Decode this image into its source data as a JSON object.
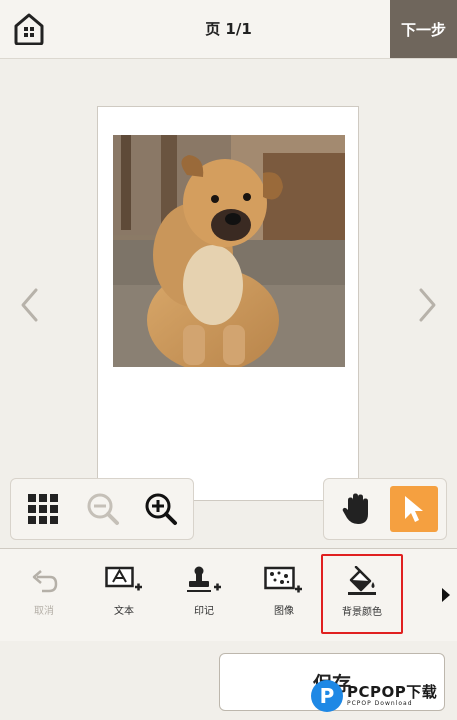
{
  "header": {
    "page_indicator": "页 1/1",
    "next_label": "下一步",
    "home_icon": "home-icon"
  },
  "canvas": {
    "photo_subject": "dog photo",
    "nav_prev_icon": "chevron-left-icon",
    "nav_next_icon": "chevron-right-icon"
  },
  "zoom_panel": {
    "layout_icon": "grid-layout-icon",
    "zoom_out_icon": "zoom-out-icon",
    "zoom_in_icon": "zoom-in-icon"
  },
  "tool_panel": {
    "hand_icon": "hand-icon",
    "select_icon": "pointer-arrow-icon",
    "select_color": "#f5a040"
  },
  "toolbar": {
    "items": [
      {
        "label": "取消",
        "icon": "undo-icon",
        "enabled": false
      },
      {
        "label": "文本",
        "icon": "add-text-icon",
        "enabled": true
      },
      {
        "label": "印记",
        "icon": "add-stamp-icon",
        "enabled": true
      },
      {
        "label": "图像",
        "icon": "add-image-icon",
        "enabled": true
      },
      {
        "label": "背景颜色",
        "icon": "background-color-icon",
        "enabled": true,
        "highlighted": true
      }
    ],
    "more_icon": "triangle-right-icon",
    "highlight_color": "#e02020"
  },
  "footer": {
    "save_label": "保存"
  },
  "watermark": {
    "logo_letter": "P",
    "brand": "PCPOP下载",
    "sub": "PCPOP Download"
  }
}
